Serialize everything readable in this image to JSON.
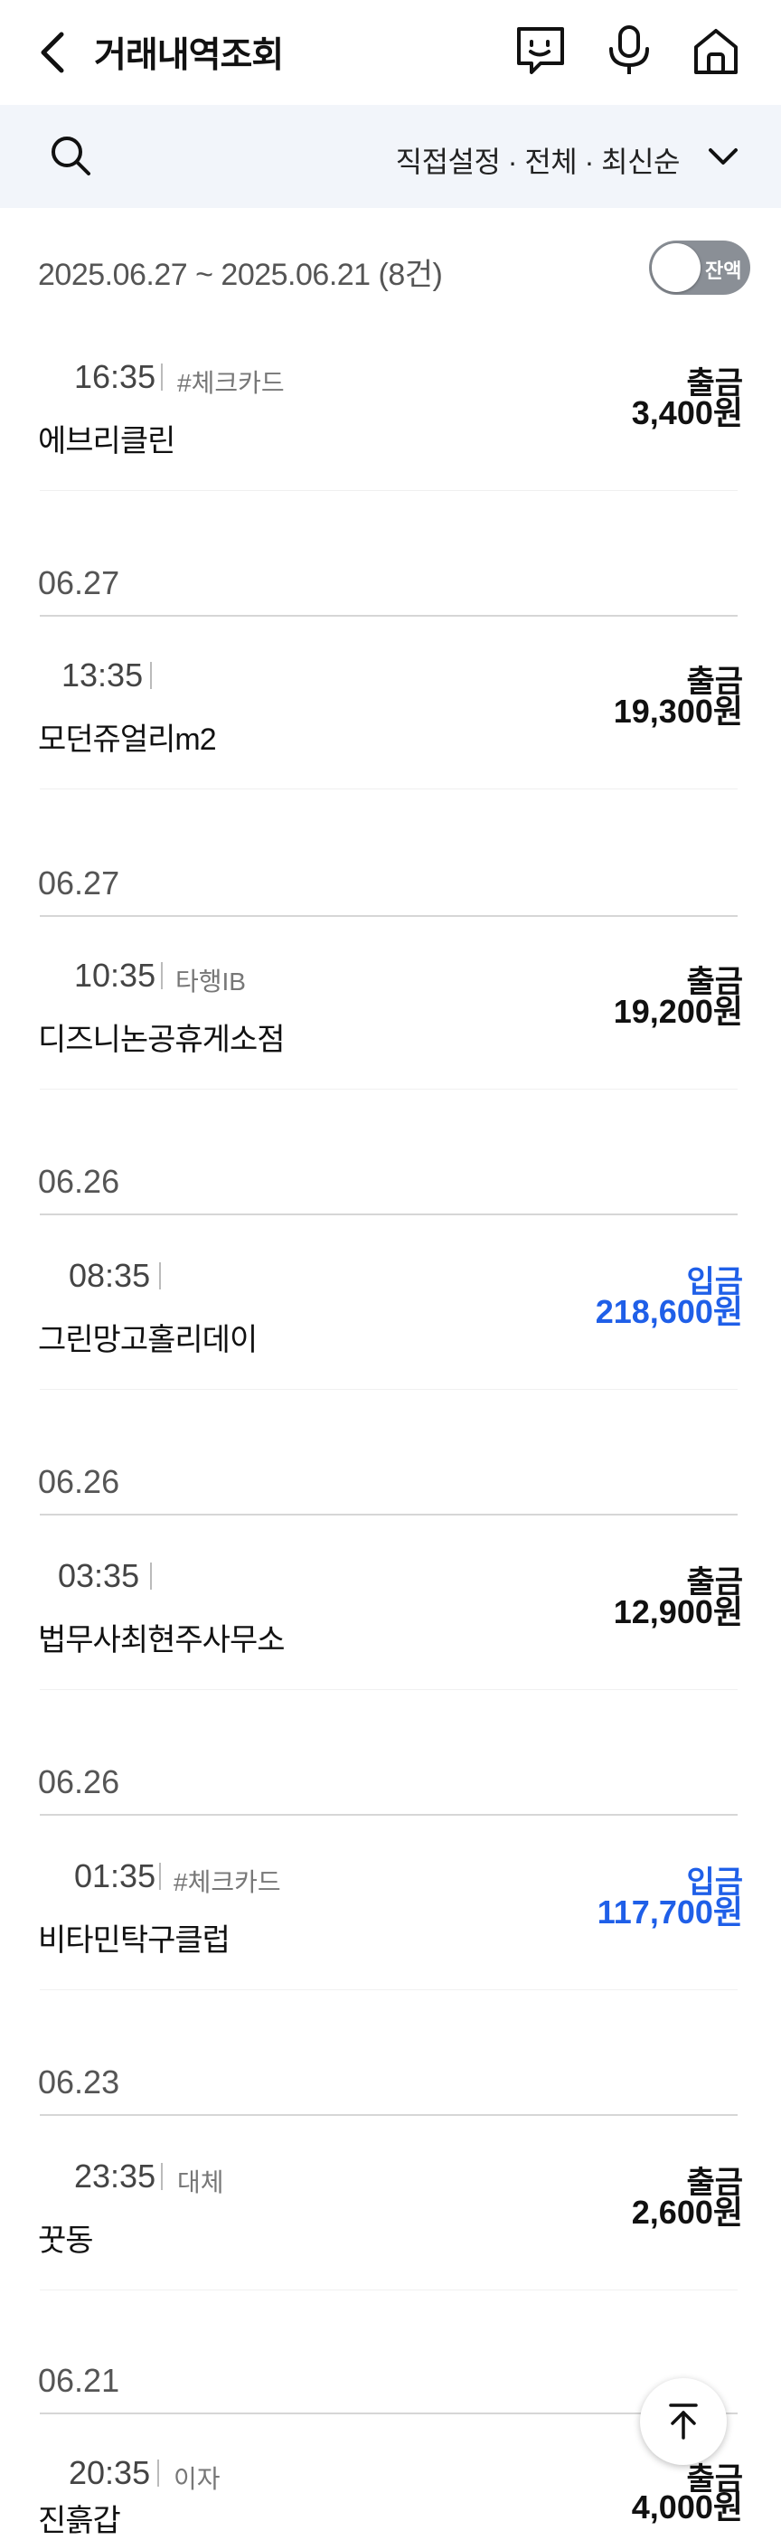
{
  "header": {
    "title": "거래내역조회"
  },
  "filter": {
    "text": "직접설정 · 전체 · 최신순"
  },
  "summary": {
    "period": "2025.06.27 ~ 2025.06.21 (8건)",
    "balance_toggle_label": "잔액"
  },
  "transactions": [
    {
      "time": "16:35",
      "tag": "#체크카드",
      "name": "에브리클린",
      "kind": "출금",
      "amount": "3,400원"
    },
    {
      "time": "13:35",
      "tag": "",
      "name": "모던쥬얼리m2",
      "kind": "출금",
      "amount": "19,300원"
    },
    {
      "time": "10:35",
      "tag": "타행IB",
      "name": "디즈니논공휴게소점",
      "kind": "출금",
      "amount": "19,200원"
    },
    {
      "time": "08:35",
      "tag": "",
      "name": "그린망고홀리데이",
      "kind": "입금",
      "amount": "218,600원"
    },
    {
      "time": "03:35",
      "tag": "",
      "name": "법무사최현주사무소",
      "kind": "출금",
      "amount": "12,900원"
    },
    {
      "time": "01:35",
      "tag": "#체크카드",
      "name": "비타민탁구클럽",
      "kind": "입금",
      "amount": "117,700원"
    },
    {
      "time": "23:35",
      "tag": "대체",
      "name": "꿋동",
      "kind": "출금",
      "amount": "2,600원"
    },
    {
      "time": "20:35",
      "tag": "이자",
      "name": "진흙갑",
      "kind": "출금",
      "amount": "4,000원"
    }
  ],
  "date_headers": [
    "06.27",
    "06.27",
    "06.26",
    "06.26",
    "06.26",
    "06.23",
    "06.21"
  ],
  "colors": {
    "deposit": "#1f5fe8",
    "filter_bg": "#f2f5fa",
    "toggle_bg": "#8a8f96"
  },
  "icons": [
    "back-arrow-icon",
    "chatbot-icon",
    "microphone-icon",
    "home-icon",
    "search-icon",
    "chevron-down-icon",
    "arrow-up-icon"
  ]
}
